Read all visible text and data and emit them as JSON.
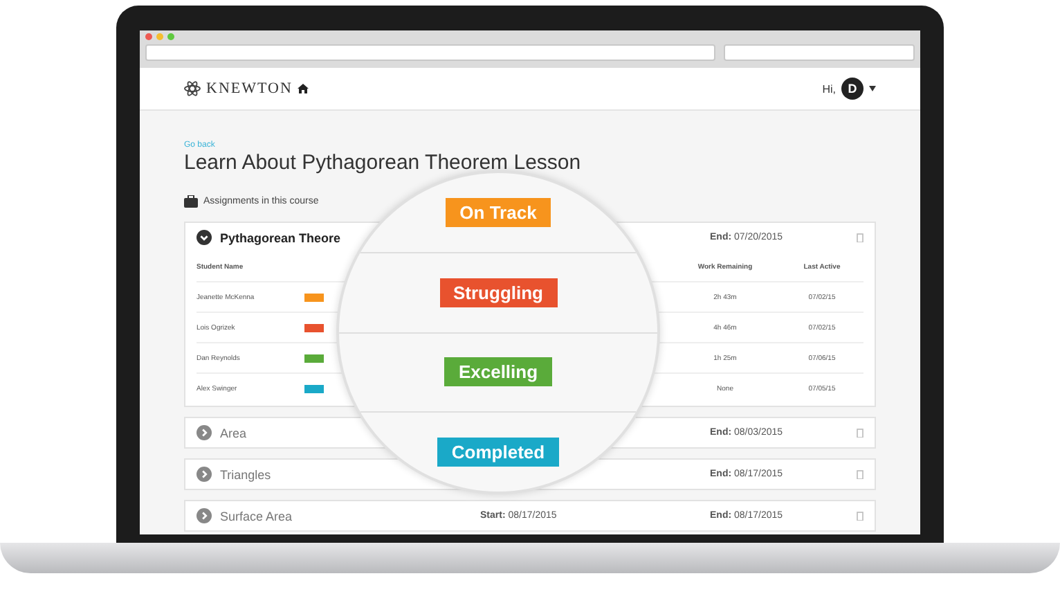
{
  "app": {
    "logo": "KNEWTON",
    "greeting": "Hi,",
    "avatar_initial": "D"
  },
  "back_link": "Go back",
  "title": "Learn About Pythagorean Theorem Lesson",
  "section_label": "Assignments in this course",
  "assignments": [
    {
      "name": "Pythagorean Theore",
      "expanded": true,
      "end_label": "End:",
      "end": "07/20/2015"
    },
    {
      "name": "Area",
      "expanded": false,
      "end_label": "End:",
      "end": "08/03/2015"
    },
    {
      "name": "Triangles",
      "expanded": false,
      "end_label": "End:",
      "end": "08/17/2015"
    },
    {
      "name": "Surface Area",
      "expanded": false,
      "start_label": "Start:",
      "start": "08/17/2015",
      "end_label": "End:",
      "end": "08/17/2015"
    }
  ],
  "table": {
    "columns": [
      "Student Name",
      "Work Remaining",
      "Last Active"
    ],
    "rows": [
      {
        "student": "Jeanette McKenna",
        "color": "#f7941d",
        "work_remaining": "2h 43m",
        "last_active": "07/02/15"
      },
      {
        "student": "Lois Ogrizek",
        "color": "#e8522e",
        "work_remaining": "4h 46m",
        "last_active": "07/02/15"
      },
      {
        "student": "Dan Reynolds",
        "color": "#5aab3a",
        "work_remaining": "1h 25m",
        "last_active": "07/06/15"
      },
      {
        "student": "Alex Swinger",
        "color": "#1aa9c8",
        "work_remaining": "None",
        "last_active": "07/05/15"
      }
    ]
  },
  "magnifier": {
    "statuses": [
      {
        "label": "On Track",
        "color": "#f7941d"
      },
      {
        "label": "Struggling",
        "color": "#e8522e"
      },
      {
        "label": "Excelling",
        "color": "#5aab3a"
      },
      {
        "label": "Completed",
        "color": "#1aa9c8"
      }
    ]
  }
}
